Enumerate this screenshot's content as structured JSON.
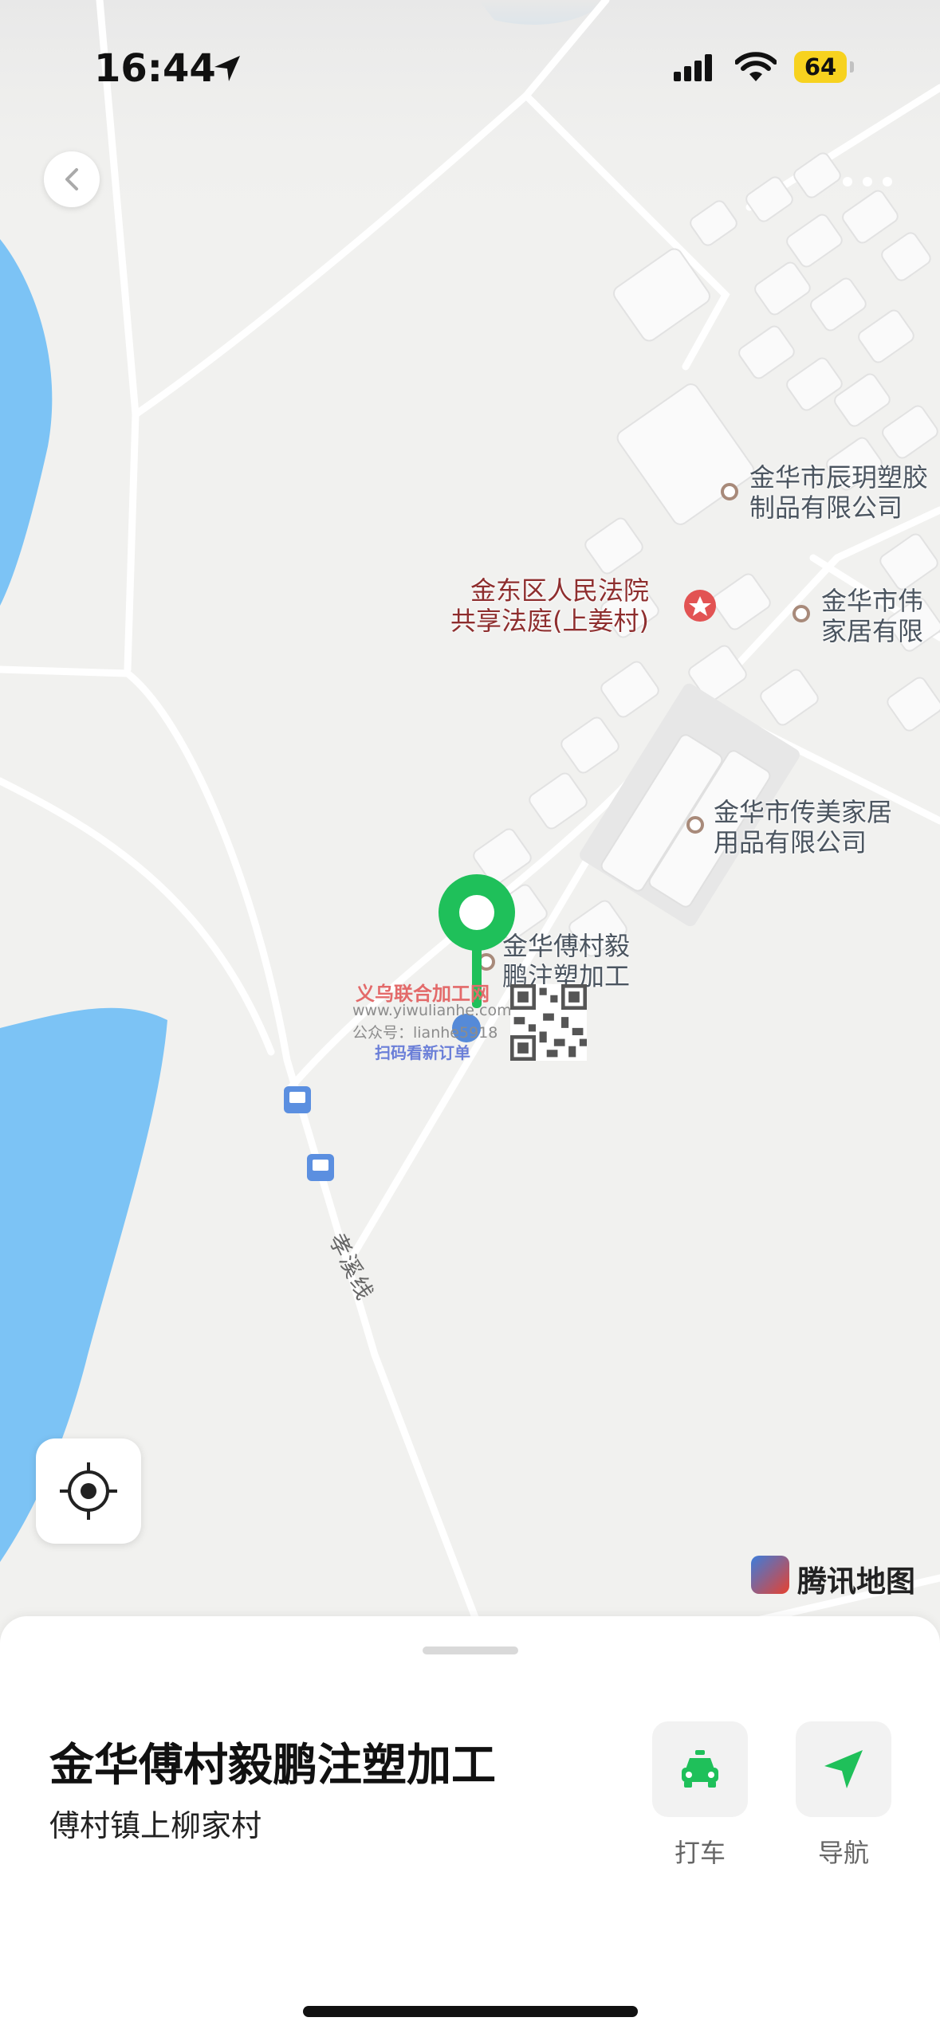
{
  "status_bar": {
    "time": "16:44",
    "battery": "64"
  },
  "map": {
    "labels": [
      {
        "id": "chenyue",
        "text": "金华市辰玥塑胶\n制品有限公司"
      },
      {
        "id": "court",
        "text": "金东区人民法院\n共享法庭(上姜村)"
      },
      {
        "id": "weijia",
        "text": "金华市伟\n家居有限"
      },
      {
        "id": "chuanmei",
        "text": "金华市传美家居\n用品有限公司"
      },
      {
        "id": "target",
        "text": "金华傅村毅\n鹏注塑加工"
      }
    ],
    "road_label": "孝溪线",
    "provider": "腾讯地图"
  },
  "watermark": {
    "title": "义乌联合加工网",
    "url": "www.yiwulianhe.com",
    "wechat": "公众号：lianhe5918",
    "scan": "扫码看新订单"
  },
  "place": {
    "name": "金华傅村毅鹏注塑加工",
    "address": "傅村镇上柳家村"
  },
  "actions": [
    {
      "label": "打车",
      "icon": "taxi-icon"
    },
    {
      "label": "导航",
      "icon": "navigation-arrow-icon"
    }
  ],
  "colors": {
    "accent_green": "#1fc05a",
    "water": "#7cc3f5",
    "map_bg": "#f1f1ef",
    "battery": "#f7d21f"
  }
}
